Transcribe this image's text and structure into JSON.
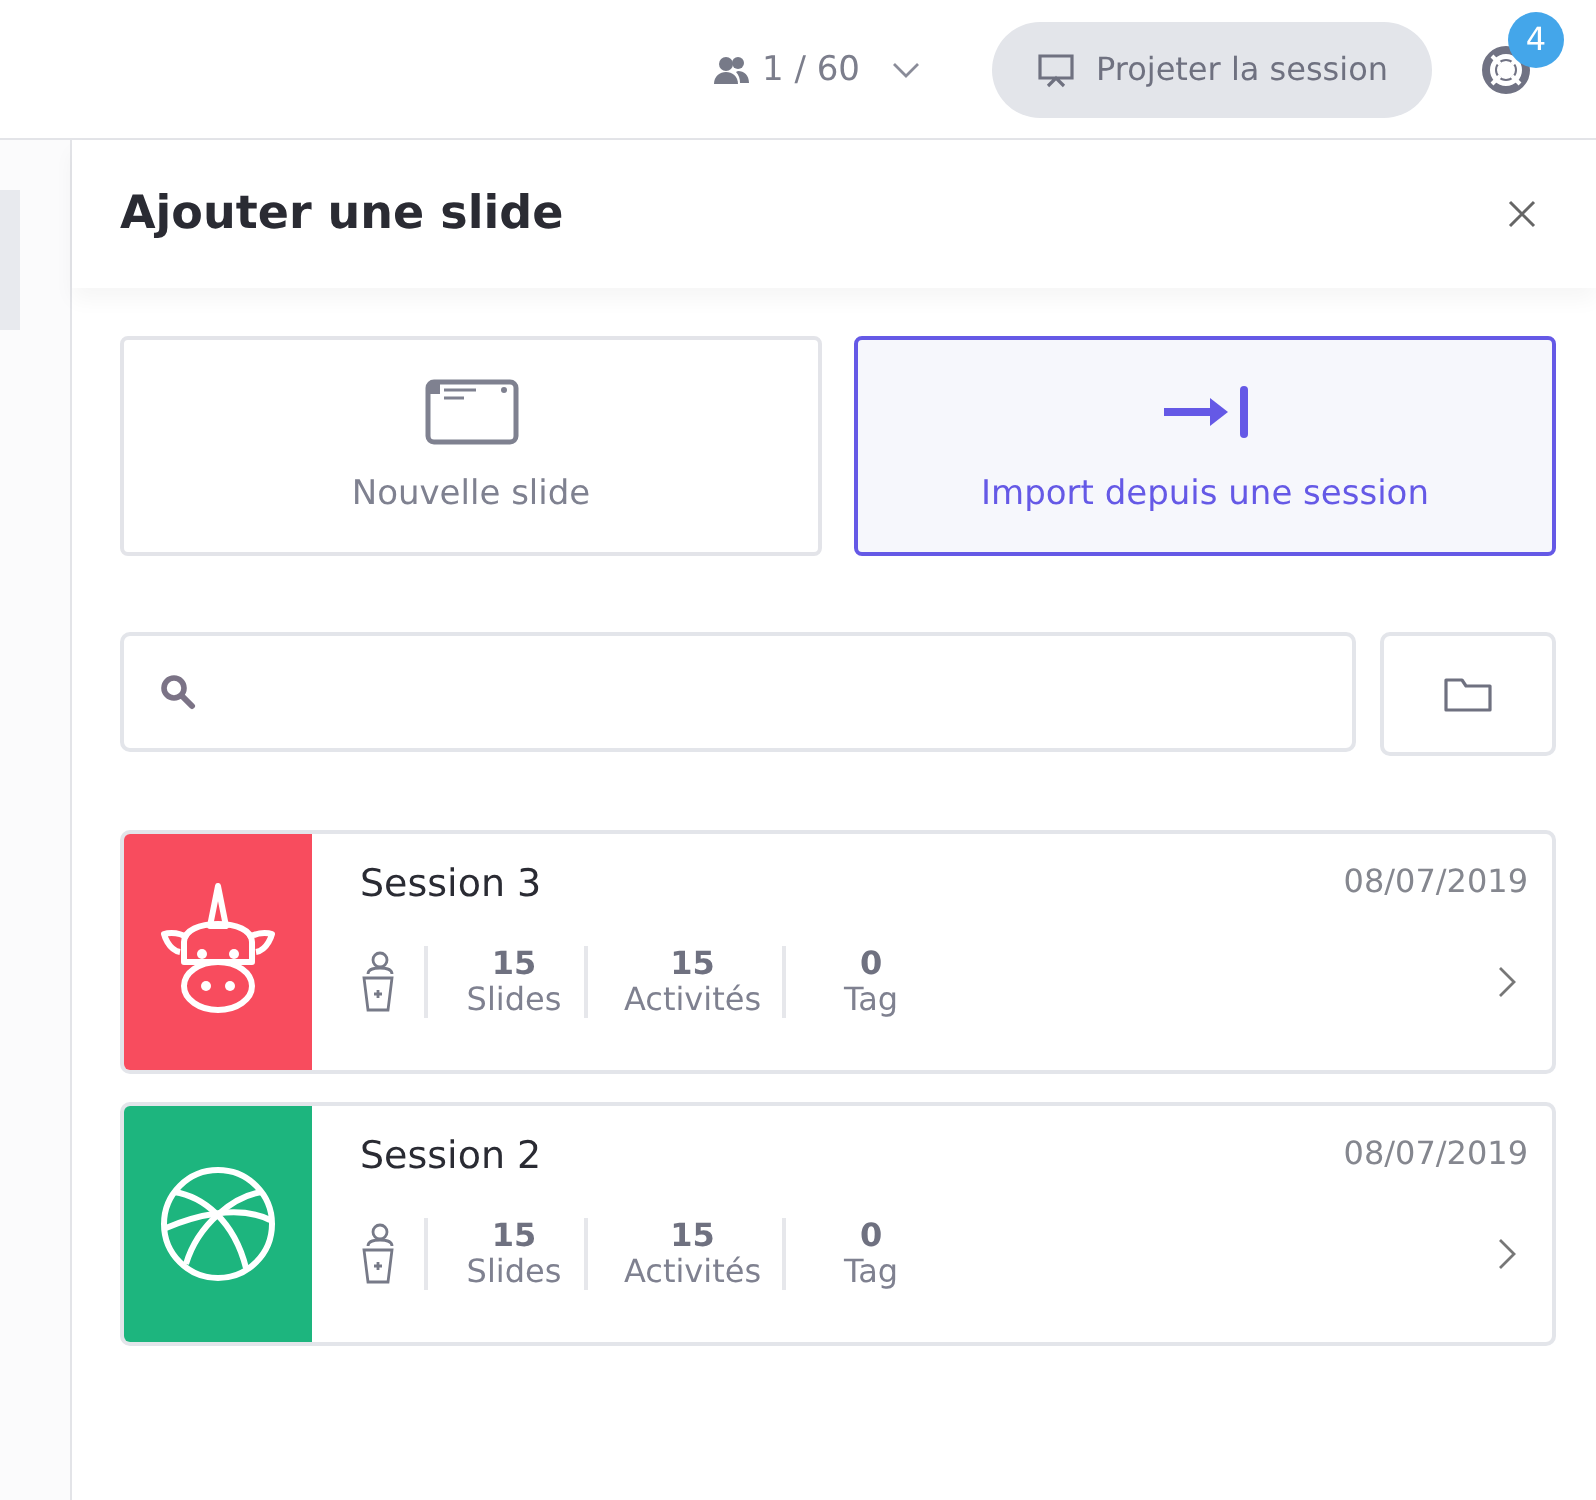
{
  "topbar": {
    "participants": "1 / 60",
    "project_button": "Projeter la session",
    "help_badge": "4"
  },
  "panel": {
    "title": "Ajouter une slide",
    "options": [
      {
        "label": "Nouvelle slide",
        "kind": "new",
        "selected": false
      },
      {
        "label": "Import depuis une session",
        "kind": "import",
        "selected": true
      }
    ],
    "sessions": [
      {
        "name": "Session 3",
        "date": "08/07/2019",
        "kind": "unicorn",
        "color": "#f84c5e",
        "stats": [
          {
            "value": "15",
            "label": "Slides"
          },
          {
            "value": "15",
            "label": "Activités"
          },
          {
            "value": "0",
            "label": "Tag"
          }
        ]
      },
      {
        "name": "Session 2",
        "date": "08/07/2019",
        "kind": "basketball",
        "color": "#1db57e",
        "stats": [
          {
            "value": "15",
            "label": "Slides"
          },
          {
            "value": "15",
            "label": "Activités"
          },
          {
            "value": "0",
            "label": "Tag"
          }
        ]
      }
    ]
  }
}
